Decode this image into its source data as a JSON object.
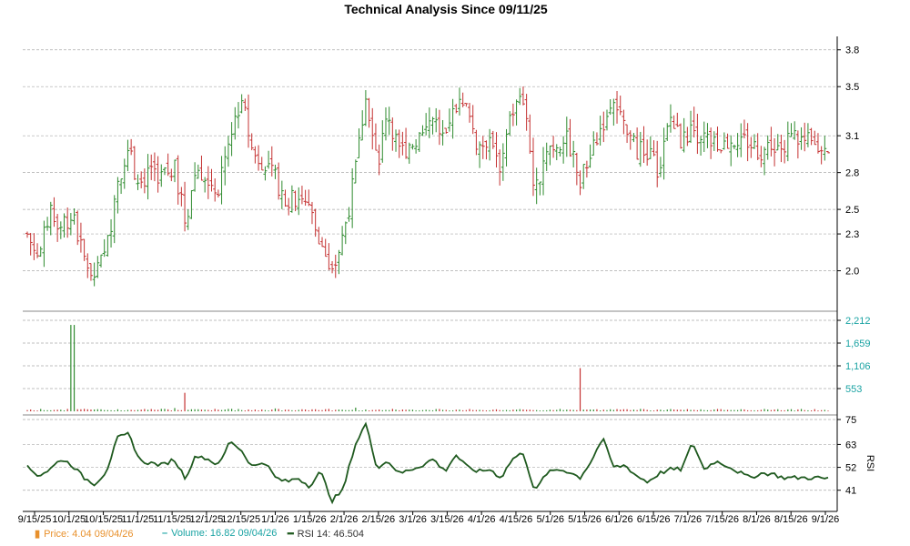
{
  "title": "Technical Analysis Since 09/11/25",
  "colors": {
    "up": "#2e8b2e",
    "down": "#c43131",
    "price_legend": "#e8902b",
    "volume_legend": "#1aa3a3",
    "rsi_line": "#1f5a1f",
    "grid": "#aaaaaa",
    "axis": "#000000",
    "price_tick": "#000000",
    "volume_tick": "#1aa3a3",
    "rsi_tick": "#000000"
  },
  "legend": {
    "price": "Price: 4.04  09/04/26",
    "volume": "Volume: 16.82  09/04/26",
    "rsi": "RSI 14: 46.504"
  },
  "chart_data": {
    "type": "ohlc",
    "x_labels": [
      "9/15/25",
      "10/1/25",
      "10/15/25",
      "11/1/25",
      "11/15/25",
      "12/1/25",
      "12/15/25",
      "1/1/26",
      "1/15/26",
      "2/1/26",
      "2/15/26",
      "3/1/26",
      "3/15/26",
      "4/1/26",
      "4/15/26",
      "5/1/26",
      "5/15/26",
      "6/1/26",
      "6/15/26",
      "7/1/26",
      "7/15/26",
      "8/1/26",
      "8/15/26",
      "9/1/26"
    ],
    "panels": {
      "price": {
        "ylim": [
          1.7,
          3.85
        ],
        "ticks": [
          "3.8",
          "3.5",
          "3.1",
          "2.8",
          "2.5",
          "2.3",
          "2.0"
        ],
        "tick_values": [
          3.8,
          3.5,
          3.1,
          2.8,
          2.5,
          2.3,
          2.0
        ]
      },
      "volume": {
        "ylim": [
          0,
          2212
        ],
        "ticks": [
          "2,212",
          "1,659",
          "1,106",
          "553"
        ],
        "tick_values": [
          2212,
          1659,
          1106,
          553
        ]
      },
      "rsi": {
        "ylim": [
          33,
          75
        ],
        "ticks": [
          "75",
          "63",
          "52",
          "41"
        ],
        "tick_values": [
          75,
          63,
          52,
          41
        ],
        "label": "RSI"
      }
    },
    "series_anchors": {
      "close": [
        2.3,
        2.1,
        2.45,
        2.4,
        2.45,
        2.1,
        1.95,
        2.15,
        2.75,
        2.95,
        2.7,
        2.85,
        2.75,
        2.85,
        2.4,
        2.85,
        2.75,
        2.65,
        3.15,
        3.4,
        2.95,
        2.9,
        2.75,
        2.55,
        2.6,
        2.55,
        2.25,
        1.95,
        2.3,
        2.75,
        3.45,
        2.85,
        3.3,
        2.95,
        3.05,
        3.1,
        3.25,
        3.05,
        3.35,
        3.3,
        3.0,
        3.1,
        2.85,
        3.3,
        3.4,
        2.6,
        3.0,
        3.05,
        3.05,
        2.7,
        3.0,
        3.2,
        3.4,
        3.1,
        3.0,
        2.95,
        2.8,
        3.25,
        3.05,
        3.15,
        3.1,
        3.0,
        3.05,
        3.1,
        3.05,
        2.95,
        3.05,
        3.0,
        3.1,
        3.05,
        3.0,
        3.05
      ],
      "rsi": [
        52,
        48,
        51,
        56,
        53,
        47,
        44,
        50,
        66,
        68,
        55,
        54,
        53,
        56,
        47,
        58,
        56,
        53,
        65,
        60,
        52,
        55,
        47,
        45,
        47,
        43,
        50,
        36,
        41,
        62,
        73,
        52,
        55,
        49,
        51,
        53,
        56,
        50,
        58,
        52,
        50,
        51,
        47,
        56,
        59,
        40,
        49,
        51,
        50,
        47,
        55,
        66,
        52,
        53,
        48,
        45,
        49,
        51,
        51,
        64,
        51,
        55,
        53,
        50,
        47,
        49,
        49,
        47,
        47,
        47,
        47,
        46.5
      ],
      "volume": [
        30,
        20,
        25,
        40,
        2100,
        60,
        45,
        30,
        50,
        35,
        40,
        55,
        60,
        80,
        450,
        50,
        35,
        40,
        60,
        30,
        25,
        30,
        70,
        40,
        35,
        25,
        30,
        20,
        40,
        90,
        45,
        35,
        30,
        25,
        40,
        30,
        25,
        35,
        40,
        30,
        35,
        25,
        30,
        40,
        45,
        30,
        25,
        35,
        40,
        1050,
        45,
        40,
        35,
        50,
        30,
        35,
        40,
        55,
        40,
        35,
        30,
        45,
        35,
        30,
        25,
        35,
        30,
        25,
        20,
        30,
        20,
        16.82
      ]
    },
    "last": {
      "price": 4.04,
      "volume": 16.82,
      "rsi": 46.504,
      "date": "09/04/26"
    }
  }
}
